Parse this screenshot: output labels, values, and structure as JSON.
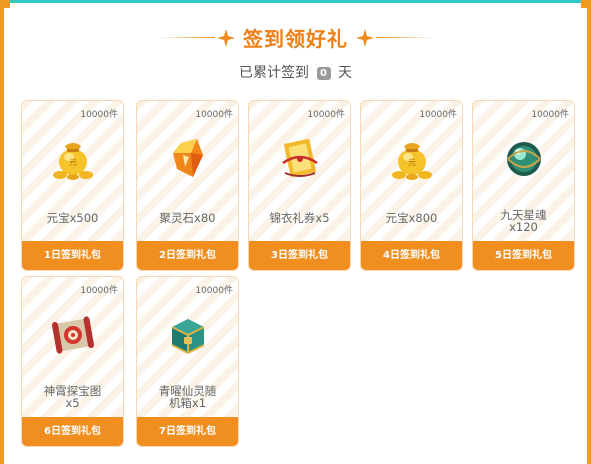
{
  "header": {
    "title": "签到领好礼",
    "subtitle_prefix": "已累计签到",
    "signed_days": "0",
    "subtitle_suffix": "天"
  },
  "icons": {
    "title_decoration": "sparkle-star-icon"
  },
  "colors": {
    "accent": "#f08e1f",
    "title": "#ee7e16",
    "card_border": "#f6d9b4",
    "frame_top": "#2ec9c4"
  },
  "rewards": [
    {
      "quantity": "10000件",
      "name": "元宝x500",
      "button": "1日签到礼包",
      "icon": "gold-ingot-bag-icon"
    },
    {
      "quantity": "10000件",
      "name": "聚灵石x80",
      "button": "2日签到礼包",
      "icon": "spirit-stone-icon"
    },
    {
      "quantity": "10000件",
      "name": "锦衣礼券x5",
      "button": "3日签到礼包",
      "icon": "gift-voucher-icon"
    },
    {
      "quantity": "10000件",
      "name": "元宝x800",
      "button": "4日签到礼包",
      "icon": "gold-ingot-bag-icon"
    },
    {
      "quantity": "10000件",
      "name_line1": "九天星魂",
      "name_line2": "x120",
      "button": "5日签到礼包",
      "icon": "star-soul-orb-icon"
    },
    {
      "quantity": "10000件",
      "name_line1": "神霄探宝图",
      "name_line2": "x5",
      "button": "6日签到礼包",
      "icon": "treasure-map-scroll-icon"
    },
    {
      "quantity": "10000件",
      "name_line1": "青曜仙灵随",
      "name_line2": "机箱x1",
      "button": "7日签到礼包",
      "icon": "jade-treasure-chest-icon"
    }
  ]
}
